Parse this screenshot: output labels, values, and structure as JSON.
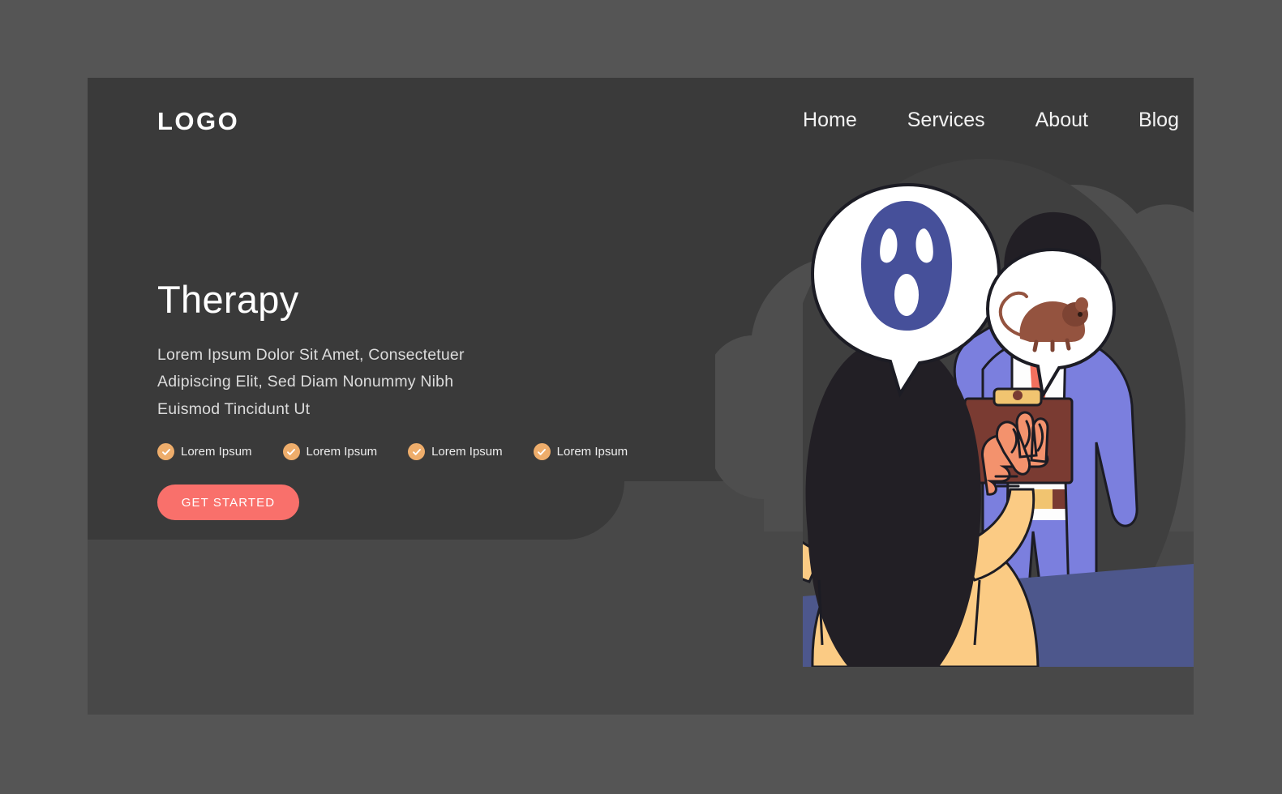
{
  "brand": {
    "logo": "LOGO"
  },
  "nav": {
    "items": [
      {
        "label": "Home"
      },
      {
        "label": "Services"
      },
      {
        "label": "About"
      },
      {
        "label": "Blog"
      }
    ]
  },
  "hero": {
    "title": "Therapy",
    "description": "Lorem Ipsum Dolor Sit Amet, Consectetuer Adipiscing Elit, Sed Diam Nonummy Nibh Euismod Tincidunt Ut",
    "features": [
      {
        "label": "Lorem Ipsum",
        "icon": "check-circle-icon"
      },
      {
        "label": "Lorem Ipsum",
        "icon": "check-circle-icon"
      },
      {
        "label": "Lorem Ipsum",
        "icon": "check-circle-icon"
      },
      {
        "label": "Lorem Ipsum",
        "icon": "check-circle-icon"
      }
    ],
    "cta": {
      "label": "GET STARTED"
    }
  },
  "illustration": {
    "alt": "Therapist with clipboard listening to seated client with fear speech bubbles",
    "bubbles": [
      {
        "icon": "screaming-ghost-face-icon",
        "meaning": "fear"
      },
      {
        "icon": "mouse-icon",
        "meaning": "phobia"
      }
    ],
    "characters": [
      {
        "name": "therapist",
        "icon": "therapist-figure-icon"
      },
      {
        "name": "client",
        "icon": "client-figure-icon"
      }
    ]
  },
  "colors": {
    "page_background": "#555555",
    "card_background": "#484848",
    "panel_background": "#3a3a3a",
    "blob": "#484848",
    "accent_cta": "#f9706b",
    "accent_check": "#eead6b",
    "suit_purple": "#7b7fde",
    "desk_blue": "#4d578c",
    "sweater_yellow": "#fbcb84",
    "skin": "#f3926d",
    "ghost_navy": "#46509a",
    "clipboard_brown": "#7a3b32",
    "text_primary": "#ffffff",
    "text_secondary": "#dcdcdc"
  }
}
